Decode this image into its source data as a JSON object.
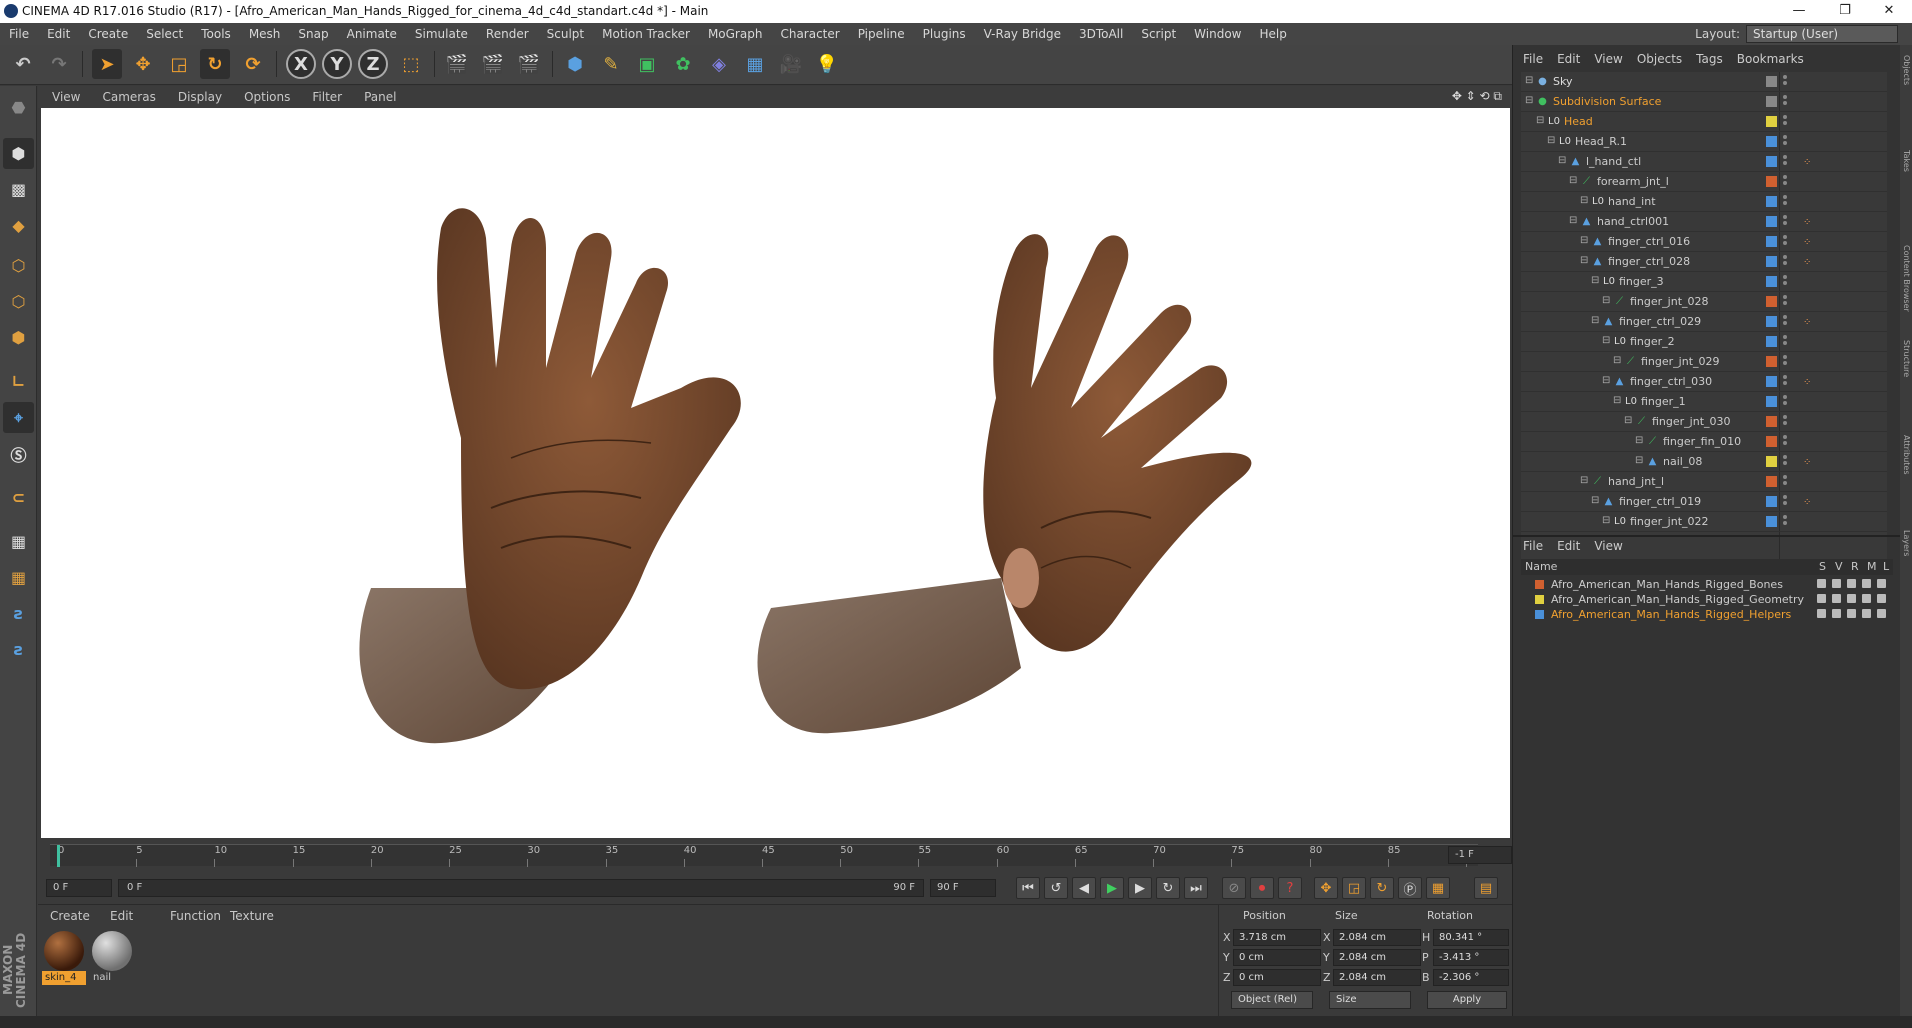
{
  "window": {
    "title": "CINEMA 4D R17.016 Studio (R17) - [Afro_American_Man_Hands_Rigged_for_cinema_4d_c4d_standart.c4d *] - Main",
    "minimize": "—",
    "restore": "❐",
    "close": "✕"
  },
  "menu": [
    "File",
    "Edit",
    "Create",
    "Select",
    "Tools",
    "Mesh",
    "Snap",
    "Animate",
    "Simulate",
    "Render",
    "Sculpt",
    "Motion Tracker",
    "MoGraph",
    "Character",
    "Pipeline",
    "Plugins",
    "V-Ray Bridge",
    "3DToAll",
    "Script",
    "Window",
    "Help"
  ],
  "layout": {
    "label": "Layout:",
    "value": "Startup (User)"
  },
  "viewport_menu": [
    "View",
    "Cameras",
    "Display",
    "Options",
    "Filter",
    "Panel"
  ],
  "axis_buttons": [
    "X",
    "Y",
    "Z"
  ],
  "timeline": {
    "ticks": [
      "0",
      "5",
      "10",
      "15",
      "20",
      "25",
      "30",
      "35",
      "40",
      "45",
      "50",
      "55",
      "60",
      "65",
      "70",
      "75",
      "80",
      "85",
      "90"
    ],
    "end_frame": "-1 F"
  },
  "transport": {
    "start": "0 F",
    "current": "0 F",
    "range_end": "90 F",
    "end": "90 F"
  },
  "material_manager": {
    "menu": [
      "Create",
      "Edit",
      "Function",
      "Texture"
    ],
    "materials": [
      {
        "name": "skin_4",
        "selected": true
      },
      {
        "name": "nail",
        "selected": false
      }
    ]
  },
  "coordinates": {
    "headers": {
      "position": "Position",
      "size": "Size",
      "rotation": "Rotation"
    },
    "rows": [
      {
        "axis": "X",
        "pos": "3.718 cm",
        "size_axis": "X",
        "size": "2.084 cm",
        "rot_axis": "H",
        "rot": "80.341 °"
      },
      {
        "axis": "Y",
        "pos": "0 cm",
        "size_axis": "Y",
        "size": "2.084 cm",
        "rot_axis": "P",
        "rot": "-3.413 °"
      },
      {
        "axis": "Z",
        "pos": "0 cm",
        "size_axis": "Z",
        "size": "2.084 cm",
        "rot_axis": "B",
        "rot": "-2.306 °"
      }
    ],
    "mode": "Object (Rel)",
    "size_mode": "Size",
    "apply": "Apply"
  },
  "object_manager": {
    "menu": [
      "File",
      "Edit",
      "View",
      "Objects",
      "Tags",
      "Bookmarks"
    ],
    "objects": [
      {
        "name": "Sky",
        "indent": 0,
        "color": "#dddddd",
        "type": "sky",
        "tag": "#888888",
        "orange": false
      },
      {
        "name": "Subdivision Surface",
        "indent": 0,
        "color": "#f0a030",
        "type": "subd",
        "tag": "#888888",
        "orange": true
      },
      {
        "name": "Head",
        "indent": 1,
        "color": "#f0a030",
        "type": "null",
        "tag": "#e0d040",
        "orange": true
      },
      {
        "name": "Head_R.1",
        "indent": 2,
        "color": "#cccccc",
        "type": "null",
        "tag": "#4a90d9",
        "orange": false
      },
      {
        "name": "l_hand_ctl",
        "indent": 3,
        "color": "#cccccc",
        "type": "ctrl",
        "tag": "#4a90d9",
        "orange": false
      },
      {
        "name": "forearm_jnt_l",
        "indent": 4,
        "color": "#cccccc",
        "type": "joint",
        "tag": "#d06030",
        "orange": false
      },
      {
        "name": "hand_int",
        "indent": 5,
        "color": "#cccccc",
        "type": "null",
        "tag": "#4a90d9",
        "orange": false
      },
      {
        "name": "hand_ctrl001",
        "indent": 4,
        "color": "#cccccc",
        "type": "ctrl",
        "tag": "#4a90d9",
        "orange": false
      },
      {
        "name": "finger_ctrl_016",
        "indent": 5,
        "color": "#cccccc",
        "type": "ctrl",
        "tag": "#4a90d9",
        "orange": false
      },
      {
        "name": "finger_ctrl_028",
        "indent": 5,
        "color": "#cccccc",
        "type": "ctrl",
        "tag": "#4a90d9",
        "orange": false
      },
      {
        "name": "finger_3",
        "indent": 6,
        "color": "#cccccc",
        "type": "null",
        "tag": "#4a90d9",
        "orange": false
      },
      {
        "name": "finger_jnt_028",
        "indent": 7,
        "color": "#cccccc",
        "type": "joint",
        "tag": "#d06030",
        "orange": false
      },
      {
        "name": "finger_ctrl_029",
        "indent": 6,
        "color": "#cccccc",
        "type": "ctrl",
        "tag": "#4a90d9",
        "orange": false
      },
      {
        "name": "finger_2",
        "indent": 7,
        "color": "#cccccc",
        "type": "null",
        "tag": "#4a90d9",
        "orange": false
      },
      {
        "name": "finger_jnt_029",
        "indent": 8,
        "color": "#cccccc",
        "type": "joint",
        "tag": "#d06030",
        "orange": false
      },
      {
        "name": "finger_ctrl_030",
        "indent": 7,
        "color": "#cccccc",
        "type": "ctrl",
        "tag": "#4a90d9",
        "orange": false
      },
      {
        "name": "finger_1",
        "indent": 8,
        "color": "#cccccc",
        "type": "null",
        "tag": "#4a90d9",
        "orange": false
      },
      {
        "name": "finger_jnt_030",
        "indent": 9,
        "color": "#cccccc",
        "type": "joint",
        "tag": "#d06030",
        "orange": false
      },
      {
        "name": "finger_fin_010",
        "indent": 10,
        "color": "#cccccc",
        "type": "joint",
        "tag": "#d06030",
        "orange": false
      },
      {
        "name": "nail_08",
        "indent": 10,
        "color": "#cccccc",
        "type": "ctrl",
        "tag": "#e0d040",
        "orange": false
      },
      {
        "name": "hand_jnt_l",
        "indent": 5,
        "color": "#cccccc",
        "type": "joint",
        "tag": "#d06030",
        "orange": false
      },
      {
        "name": "finger_ctrl_019",
        "indent": 6,
        "color": "#cccccc",
        "type": "ctrl",
        "tag": "#4a90d9",
        "orange": false
      },
      {
        "name": "finger_jnt_022",
        "indent": 7,
        "color": "#cccccc",
        "type": "null",
        "tag": "#4a90d9",
        "orange": false
      }
    ]
  },
  "layer_manager": {
    "menu": [
      "File",
      "Edit",
      "View"
    ],
    "header": {
      "name": "Name",
      "cols": [
        "S",
        "V",
        "R",
        "M",
        "L"
      ]
    },
    "layers": [
      {
        "name": "Afro_American_Man_Hands_Rigged_Bones",
        "color": "#d06030",
        "active": false
      },
      {
        "name": "Afro_American_Man_Hands_Rigged_Geometry",
        "color": "#e0d040",
        "active": false
      },
      {
        "name": "Afro_American_Man_Hands_Rigged_Helpers",
        "color": "#4a90d9",
        "active": true
      }
    ]
  },
  "side_tabs": [
    "Objects",
    "Takes",
    "Content Browser",
    "Structure",
    "Attributes",
    "Layers"
  ],
  "brand": "MAXON CINEMA 4D",
  "colors": {
    "accent_orange": "#f0a030",
    "skin": "#6b4428",
    "bg": "#3a3a3a"
  }
}
